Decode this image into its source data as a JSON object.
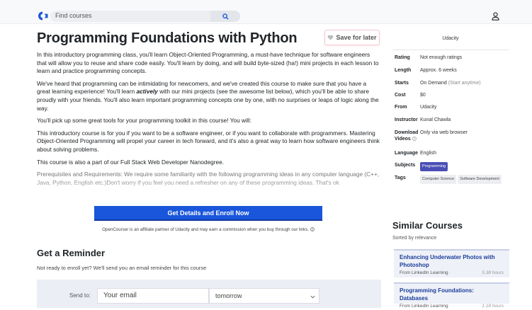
{
  "search": {
    "placeholder": "Find courses"
  },
  "course": {
    "title": "Programming Foundations with Python",
    "save_label": "Save for later",
    "description": {
      "p1": "In this introductory programming class, you'll learn Object-Oriented Programming, a must-have technique for software engineers that will allow you to reuse and share code easily. You'll learn by doing, and will build byte-sized (ha!) mini projects in each lesson to learn and practice programming concepts.",
      "p2_a": "We've heard that programming can be intimidating for newcomers, and we've created this course to make sure that you have a great learning experience! You'll learn ",
      "p2_em": "actively",
      "p2_b": " with our mini projects (see the awesome list below), which you'll be able to share proudly with your friends. You'll also learn important programming concepts one by one, with no surprises or leaps of logic along the way.",
      "p3": "You'll pick up some great tools for your programming toolkit in this course! You will:",
      "p4": "This introductory course is for you if you want to be a software engineer, or if you want to collaborate with programmers. Mastering Object-Oriented Programming will propel your career in tech forward, and it's also a great way to learn how software engineers think about solving problems.",
      "p5": "This course is also a part of our Full Stack Web Developer Nanodegree.",
      "p6": "Prerequisites and Requirements: We require some familiarity with the following programming ideas in any computer language (C++, Java, Python, English etc.)Don't worry if you feel you need a refresher on any of these programming ideas. That's ok"
    },
    "enroll_label": "Get Details and Enroll Now",
    "affiliate_note": "OpenCourser is an affiliate partner of Udacity and may earn a commission when you buy through our links."
  },
  "reminder": {
    "title": "Get a Reminder",
    "subtitle": "Not ready to enroll yet? We'll send you an email reminder for this course",
    "send_to_label": "Send to:",
    "email_placeholder": "Your email",
    "when_value": "tomorrow"
  },
  "sidebar": {
    "provider": "Udacity",
    "rows": {
      "rating": {
        "k": "Rating",
        "v": "Not enough ratings"
      },
      "length": {
        "k": "Length",
        "v": "Approx. 6 weeks"
      },
      "starts": {
        "k": "Starts",
        "v": "On Demand",
        "note": "(Start anytime)"
      },
      "cost": {
        "k": "Cost",
        "v": "$0"
      },
      "from": {
        "k": "From",
        "v": "Udacity"
      },
      "instructor": {
        "k": "Instructor",
        "v": "Kunal Chawla"
      },
      "download": {
        "k": "Download Videos",
        "v": "Only via web browser"
      },
      "language": {
        "k": "Language",
        "v": "English"
      },
      "subjects": {
        "k": "Subjects",
        "v": "Programming"
      },
      "tags": {
        "k": "Tags",
        "v1": "Computer Science",
        "v2": "Software Development"
      }
    },
    "similar": {
      "title": "Similar Courses",
      "sorted": "Sorted by relevance",
      "items": [
        {
          "title": "Enhancing Underwater Photos with Photoshop",
          "source": "From LinkedIn Learning",
          "duration": "5.38 hours"
        },
        {
          "title": "Programming Foundations: Databases",
          "source": "From LinkedIn Learning",
          "duration": "1.18 hours"
        }
      ]
    }
  },
  "colors": {
    "accent": "#1a56db",
    "brand": "#1e56d6",
    "badge": "#4a4fb5"
  }
}
